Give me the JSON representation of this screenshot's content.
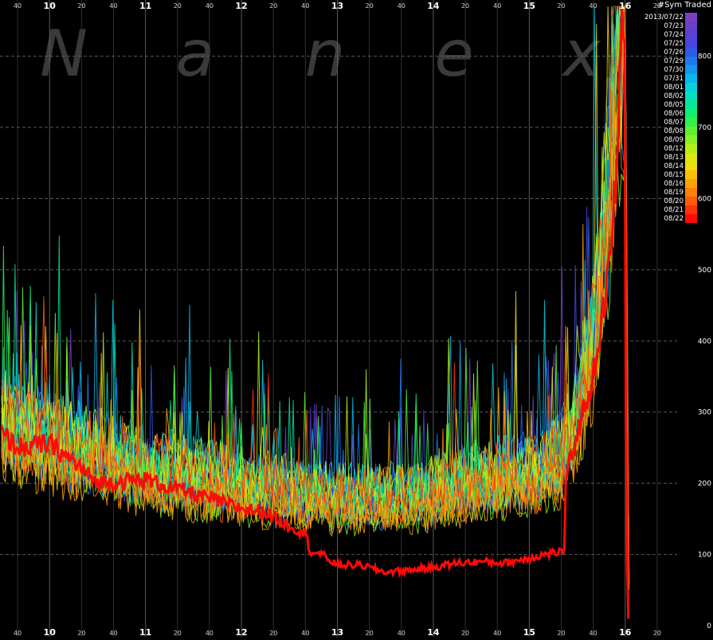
{
  "watermark": "Nanex",
  "chart_data": {
    "type": "line",
    "title": "",
    "xlabel": "",
    "ylabel": "#Sym Traded",
    "ylim": [
      0,
      870
    ],
    "grid": true,
    "x_axis": {
      "start": "09:30",
      "end": "16:30",
      "major_ticks": [
        {
          "time": "10:00",
          "label": "10"
        },
        {
          "time": "11:00",
          "label": "11"
        },
        {
          "time": "12:00",
          "label": "12"
        },
        {
          "time": "13:00",
          "label": "13"
        },
        {
          "time": "14:00",
          "label": "14"
        },
        {
          "time": "15:00",
          "label": "15"
        },
        {
          "time": "16:00",
          "label": "16"
        }
      ],
      "minor_ticks": [
        {
          "time": "09:40",
          "label": "40"
        },
        {
          "time": "10:20",
          "label": "20"
        },
        {
          "time": "10:40",
          "label": "40"
        },
        {
          "time": "11:20",
          "label": "20"
        },
        {
          "time": "11:40",
          "label": "40"
        },
        {
          "time": "12:20",
          "label": "20"
        },
        {
          "time": "12:40",
          "label": "40"
        },
        {
          "time": "13:20",
          "label": "20"
        },
        {
          "time": "13:40",
          "label": "40"
        },
        {
          "time": "14:20",
          "label": "20"
        },
        {
          "time": "14:40",
          "label": "40"
        },
        {
          "time": "15:20",
          "label": "20"
        },
        {
          "time": "15:40",
          "label": "40"
        },
        {
          "time": "16:20",
          "label": "20"
        }
      ]
    },
    "y_ticks": [
      0,
      100,
      200,
      300,
      400,
      500,
      600,
      700,
      800
    ],
    "legend": {
      "placement": "top-right",
      "entries": [
        {
          "label": "2013/07/22",
          "color": "#7a3fbf"
        },
        {
          "label": "07/23",
          "color": "#6a3fc8"
        },
        {
          "label": "07/24",
          "color": "#5a40d4"
        },
        {
          "label": "07/25",
          "color": "#4448e0"
        },
        {
          "label": "07/26",
          "color": "#2f5ae8"
        },
        {
          "label": "07/29",
          "color": "#1f78ee"
        },
        {
          "label": "07/30",
          "color": "#1298f0"
        },
        {
          "label": "07/31",
          "color": "#0ab6ee"
        },
        {
          "label": "08/01",
          "color": "#05d0e0"
        },
        {
          "label": "08/02",
          "color": "#04e0c0"
        },
        {
          "label": "08/05",
          "color": "#06e898"
        },
        {
          "label": "08/06",
          "color": "#10ee70"
        },
        {
          "label": "08/07",
          "color": "#30f04a"
        },
        {
          "label": "08/08",
          "color": "#5cf030"
        },
        {
          "label": "08/09",
          "color": "#8af020"
        },
        {
          "label": "08/12",
          "color": "#b4ee14"
        },
        {
          "label": "08/13",
          "color": "#d8ea0c"
        },
        {
          "label": "08/14",
          "color": "#f0dc08"
        },
        {
          "label": "08/15",
          "color": "#f8c006"
        },
        {
          "label": "08/16",
          "color": "#fca206"
        },
        {
          "label": "08/19",
          "color": "#fe8006"
        },
        {
          "label": "08/20",
          "color": "#ff5c06"
        },
        {
          "label": "08/21",
          "color": "#ff3406"
        },
        {
          "label": "08/22",
          "color": "#ff0a06"
        }
      ]
    },
    "series_profile_note_removed": true,
    "background_series_profile": [
      {
        "time": "09:30",
        "value": 280
      },
      {
        "time": "09:40",
        "value": 270
      },
      {
        "time": "10:00",
        "value": 255
      },
      {
        "time": "10:30",
        "value": 235
      },
      {
        "time": "11:00",
        "value": 215
      },
      {
        "time": "11:30",
        "value": 205
      },
      {
        "time": "12:00",
        "value": 195
      },
      {
        "time": "12:30",
        "value": 185
      },
      {
        "time": "13:00",
        "value": 178
      },
      {
        "time": "13:30",
        "value": 175
      },
      {
        "time": "14:00",
        "value": 185
      },
      {
        "time": "14:30",
        "value": 200
      },
      {
        "time": "15:00",
        "value": 210
      },
      {
        "time": "15:20",
        "value": 230
      },
      {
        "time": "15:30",
        "value": 290
      },
      {
        "time": "15:40",
        "value": 400
      },
      {
        "time": "15:50",
        "value": 620
      },
      {
        "time": "15:56",
        "value": 830
      },
      {
        "time": "16:00",
        "value": 830
      },
      {
        "time": "16:02",
        "value": 100
      },
      {
        "time": "16:03",
        "value": 20
      }
    ],
    "series": [
      {
        "name": "08/22",
        "color": "#ff0a06",
        "points": [
          {
            "time": "09:30",
            "value": 270
          },
          {
            "time": "09:40",
            "value": 250
          },
          {
            "time": "10:00",
            "value": 255
          },
          {
            "time": "10:15",
            "value": 230
          },
          {
            "time": "10:30",
            "value": 200
          },
          {
            "time": "11:00",
            "value": 205
          },
          {
            "time": "11:30",
            "value": 185
          },
          {
            "time": "12:00",
            "value": 165
          },
          {
            "time": "12:15",
            "value": 160
          },
          {
            "time": "12:30",
            "value": 140
          },
          {
            "time": "12:40",
            "value": 130
          },
          {
            "time": "12:43",
            "value": 105
          },
          {
            "time": "12:50",
            "value": 100
          },
          {
            "time": "13:00",
            "value": 85
          },
          {
            "time": "13:15",
            "value": 85
          },
          {
            "time": "13:30",
            "value": 75
          },
          {
            "time": "13:45",
            "value": 78
          },
          {
            "time": "14:00",
            "value": 82
          },
          {
            "time": "14:15",
            "value": 88
          },
          {
            "time": "14:30",
            "value": 90
          },
          {
            "time": "14:45",
            "value": 88
          },
          {
            "time": "15:00",
            "value": 95
          },
          {
            "time": "15:10",
            "value": 100
          },
          {
            "time": "15:22",
            "value": 105
          },
          {
            "time": "15:23",
            "value": 210
          },
          {
            "time": "15:30",
            "value": 270
          },
          {
            "time": "15:40",
            "value": 350
          },
          {
            "time": "15:50",
            "value": 500
          },
          {
            "time": "15:55",
            "value": 650
          },
          {
            "time": "15:58",
            "value": 860
          },
          {
            "time": "16:00",
            "value": 860
          },
          {
            "time": "16:00",
            "value": 420
          },
          {
            "time": "16:01",
            "value": 120
          },
          {
            "time": "16:02",
            "value": 10
          }
        ]
      }
    ]
  }
}
